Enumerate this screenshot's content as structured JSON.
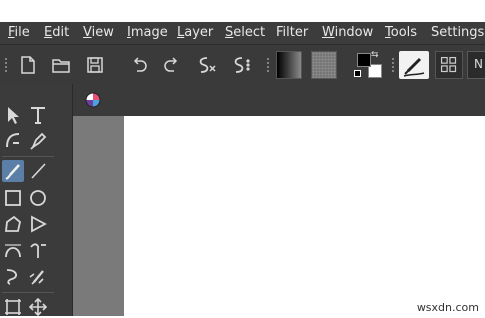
{
  "menubar": {
    "items": [
      {
        "label": "File",
        "access": "F",
        "rest": "ile"
      },
      {
        "label": "Edit",
        "access": "E",
        "rest": "dit"
      },
      {
        "label": "View",
        "access": "V",
        "rest": "iew"
      },
      {
        "label": "Image",
        "access": "I",
        "rest": "mage"
      },
      {
        "label": "Layer",
        "access": "L",
        "rest": "ayer"
      },
      {
        "label": "Select",
        "access": "S",
        "rest": "elect"
      },
      {
        "label": "Filter",
        "access": "",
        "rest": "Filter"
      },
      {
        "label": "Window",
        "access": "W",
        "rest": "indow"
      },
      {
        "label": "Tools",
        "access": "T",
        "rest": "ools"
      },
      {
        "label": "Settings",
        "access": "",
        "rest": "Settings"
      }
    ]
  },
  "toolbar": {
    "icons": [
      "new-document-icon",
      "open-folder-icon",
      "save-icon",
      "undo-icon",
      "redo-icon",
      "erase-path-icon",
      "symmetry-icon"
    ],
    "foreground_color": "#000000",
    "background_color": "#ffffff",
    "cut_field_text": "N"
  },
  "toolbox": {
    "active_tool": "freehand-brush-tool"
  },
  "colors": {
    "menubar_bg": "#3c3c3c",
    "toolbar_bg": "#3a3a3a",
    "canvas_bg": "#7a7a7a",
    "active_tool_bg": "#5b7fa6"
  },
  "watermark": "wsxdn.com"
}
